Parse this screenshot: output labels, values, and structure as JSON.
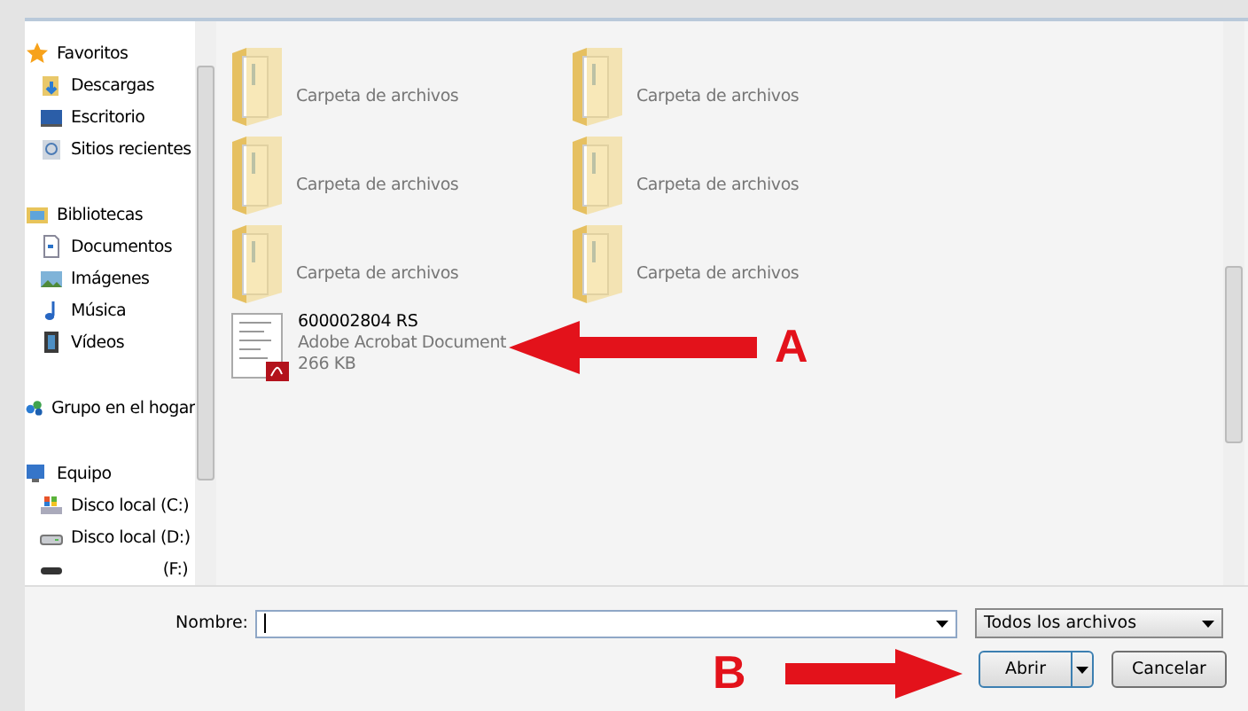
{
  "navigation": [
    {
      "label": "Favoritos",
      "children": [
        {
          "label": "Descargas"
        },
        {
          "label": "Escritorio"
        },
        {
          "label": "Sitios recientes"
        }
      ]
    },
    {
      "label": "Bibliotecas",
      "children": [
        {
          "label": "Documentos"
        },
        {
          "label": "Imágenes"
        },
        {
          "label": "Música"
        },
        {
          "label": "Vídeos"
        }
      ]
    },
    {
      "label": "Grupo en el hogar"
    },
    {
      "label": "Equipo",
      "children": [
        {
          "label": "Disco local (C:)"
        },
        {
          "label": "Disco local (D:)"
        },
        {
          "label": "(F:)"
        }
      ]
    }
  ],
  "files": [
    {
      "kind": "folder",
      "type": "Carpeta de archivos"
    },
    {
      "kind": "folder",
      "type": "Carpeta de archivos"
    },
    {
      "kind": "folder",
      "type": "Carpeta de archivos"
    },
    {
      "kind": "folder",
      "type": "Carpeta de archivos"
    },
    {
      "kind": "folder",
      "type": "Carpeta de archivos"
    },
    {
      "kind": "folder",
      "type": "Carpeta de archivos"
    },
    {
      "kind": "pdf",
      "name": "600002804 RS",
      "type": "Adobe Acrobat Document",
      "size": "266 KB"
    }
  ],
  "footer": {
    "name_label": "Nombre:",
    "filter": "Todos los archivos",
    "buttons": [
      "Abrir",
      "Cancelar"
    ]
  },
  "annotations": [
    "A",
    "B"
  ]
}
